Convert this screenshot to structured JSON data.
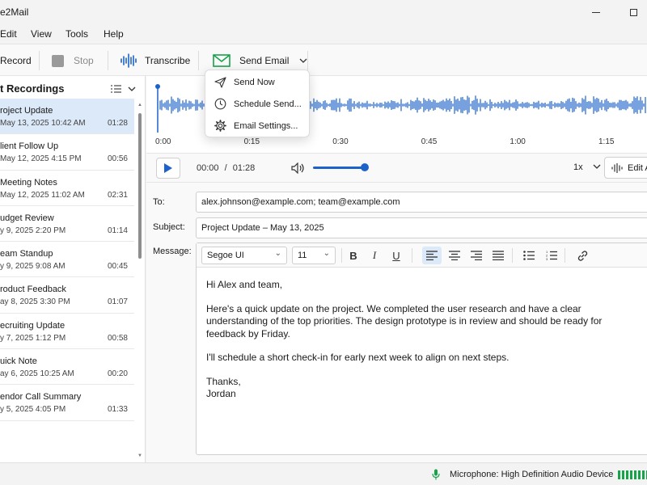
{
  "window": {
    "title": "e2Mail"
  },
  "menu": [
    "Edit",
    "View",
    "Tools",
    "Help"
  ],
  "toolbar": {
    "record_label": "Record",
    "stop_label": "Stop",
    "transcribe_label": "Transcribe",
    "send_email_label": "Send Email",
    "send_email_color": "#16a34a",
    "transcribe_color": "#1d62c9"
  },
  "send_menu": {
    "items": [
      {
        "label": "Send Now",
        "icon": "send-icon"
      },
      {
        "label": "Schedule Send...",
        "icon": "clock-icon"
      },
      {
        "label": "Email Settings...",
        "icon": "gear-icon"
      }
    ]
  },
  "sidebar": {
    "title": "t Recordings",
    "recordings": [
      {
        "name": "roject Update",
        "date": "May 13, 2025 10:42 AM",
        "duration": "01:28",
        "selected": true
      },
      {
        "name": "lient Follow Up",
        "date": "May 12, 2025 4:15 PM",
        "duration": "00:56"
      },
      {
        "name": "Meeting Notes",
        "date": "May 12, 2025 11:02 AM",
        "duration": "02:31"
      },
      {
        "name": "udget Review",
        "date": "y 9, 2025 2:20 PM",
        "duration": "01:14"
      },
      {
        "name": "eam Standup",
        "date": "y 9, 2025 9:08 AM",
        "duration": "00:45"
      },
      {
        "name": "roduct Feedback",
        "date": "ay 8, 2025 3:30 PM",
        "duration": "01:07"
      },
      {
        "name": "ecruiting Update",
        "date": "y 7, 2025 1:12 PM",
        "duration": "00:58"
      },
      {
        "name": "uick Note",
        "date": "ay 6, 2025 10:25 AM",
        "duration": "00:20"
      },
      {
        "name": "endor Call Summary",
        "date": "y 5, 2025 4:05 PM",
        "duration": "01:33"
      }
    ]
  },
  "waveform": {
    "color": "#1d62c9",
    "time_labels": [
      "0:00",
      "0:15",
      "0:30",
      "0:45",
      "1:00",
      "1:15"
    ]
  },
  "player": {
    "current": "00:00",
    "separator": "/",
    "total": "01:28",
    "volume": 0.9,
    "speed": "1x",
    "edit_label": "Edit A"
  },
  "email": {
    "to_label": "To:",
    "to_value": "alex.johnson@example.com; team@example.com",
    "subject_label": "Subject:",
    "subject_value": "Project Update – May 13, 2025",
    "message_label": "Message:",
    "font": "Segoe UI",
    "size": "11",
    "body": [
      "Hi Alex and team,",
      "Here's a quick update on the project. We completed the user research and have a clear understanding of the top priorities. The design prototype is in review and should be ready for feedback by Friday.",
      "I'll schedule a short check-in for early next week to align on next steps.",
      "Thanks,",
      "Jordan"
    ]
  },
  "status": {
    "microphone": "Microphone: High Definition Audio Device",
    "level_color": "#16a34a"
  }
}
